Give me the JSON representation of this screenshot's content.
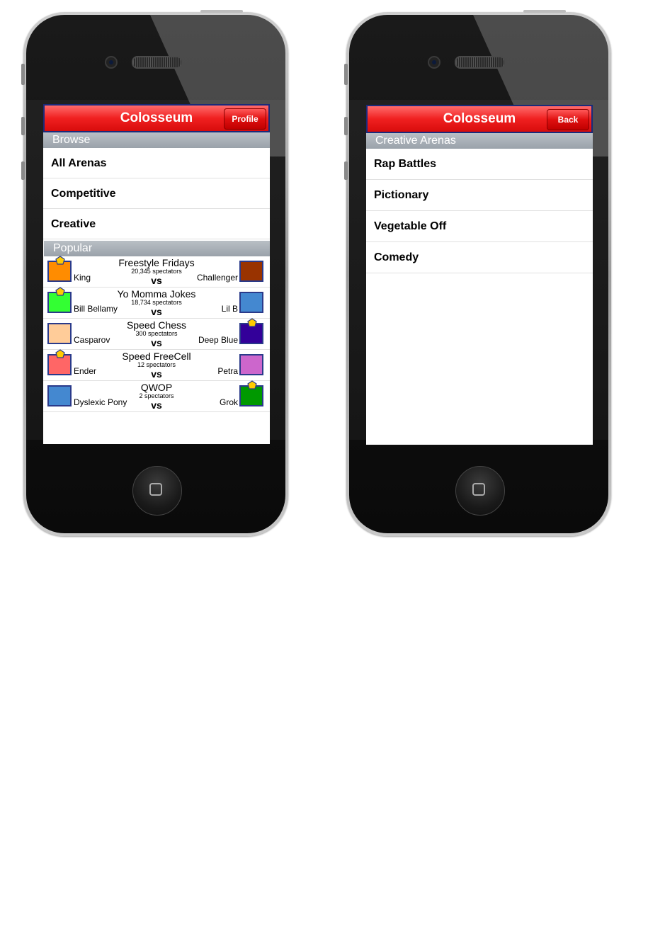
{
  "left_screen": {
    "navbar": {
      "title": "Colosseum",
      "button_label": "Profile"
    },
    "browse_header": "Browse",
    "browse_items": [
      "All Arenas",
      "Competitive",
      "Creative"
    ],
    "popular_header": "Popular",
    "matches": [
      {
        "title": "Freestyle Fridays",
        "spectators": "20,345 spectators",
        "vs": "vs",
        "left": {
          "name": "King",
          "color": "#ff8c00",
          "crown": true
        },
        "right": {
          "name": "Challenger",
          "color": "#993300",
          "crown": false
        }
      },
      {
        "title": "Yo Momma Jokes",
        "spectators": "18,734 spectators",
        "vs": "vs",
        "left": {
          "name": "Bill Bellamy",
          "color": "#33ff33",
          "crown": true
        },
        "right": {
          "name": "Lil B",
          "color": "#4488d0",
          "crown": false
        }
      },
      {
        "title": "Speed Chess",
        "spectators": "300 spectators",
        "vs": "vs",
        "left": {
          "name": "Casparov",
          "color": "#ffcc99",
          "crown": false
        },
        "right": {
          "name": "Deep Blue",
          "color": "#330099",
          "crown": true
        }
      },
      {
        "title": "Speed FreeCell",
        "spectators": "12 spectators",
        "vs": "vs",
        "left": {
          "name": "Ender",
          "color": "#ff6666",
          "crown": true
        },
        "right": {
          "name": "Petra",
          "color": "#cc66cc",
          "crown": false
        }
      },
      {
        "title": "QWOP",
        "spectators": "2 spectators",
        "vs": "vs",
        "left": {
          "name": "Dyslexic Pony",
          "color": "#4488d0",
          "crown": false
        },
        "right": {
          "name": "Grok",
          "color": "#009900",
          "crown": true
        }
      }
    ]
  },
  "right_screen": {
    "navbar": {
      "title": "Colosseum",
      "button_label": "Back"
    },
    "section_header": "Creative Arenas",
    "items": [
      "Rap Battles",
      "Pictionary",
      "Vegetable Off",
      "Comedy"
    ]
  },
  "colors": {
    "navbar_red": "#f02020",
    "navbar_border": "#1a2a7a",
    "crown_gold": "#ffcc00"
  }
}
